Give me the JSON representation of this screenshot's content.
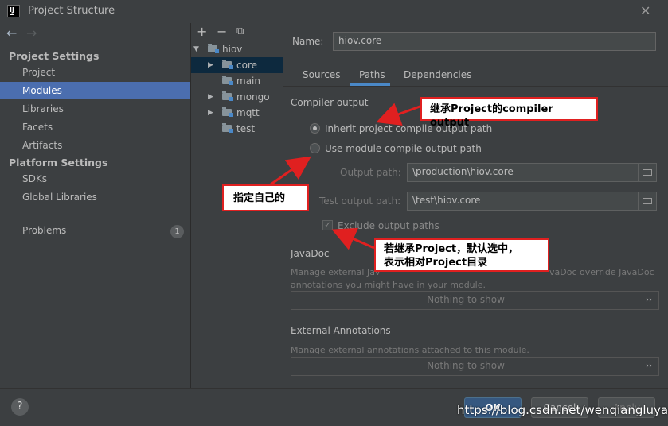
{
  "window": {
    "title": "Project Structure",
    "logo_text": "IJ"
  },
  "sidebar": {
    "sections": [
      {
        "title": "Project Settings",
        "items": [
          "Project",
          "Modules",
          "Libraries",
          "Facets",
          "Artifacts"
        ]
      },
      {
        "title": "Platform Settings",
        "items": [
          "SDKs",
          "Global Libraries"
        ]
      }
    ],
    "selected": "Modules",
    "problems_label": "Problems",
    "problems_count": "1"
  },
  "tree": {
    "root": "hiov",
    "children": [
      "core",
      "main",
      "mongo",
      "mqtt",
      "test"
    ],
    "selected": "core"
  },
  "module": {
    "name_label": "Name:",
    "name_value": "hiov.core",
    "tabs": [
      "Sources",
      "Paths",
      "Dependencies"
    ],
    "active_tab": "Paths"
  },
  "compiler_output": {
    "title": "Compiler output",
    "inherit_label": "Inherit project compile output path",
    "use_module_label": "Use module compile output path",
    "selected": "inherit",
    "output_path_label": "Output path:",
    "output_path_value": "\\production\\hiov.core",
    "test_output_path_label": "Test output path:",
    "test_output_path_value": "\\test\\hiov.core",
    "exclude_label": "Exclude output paths",
    "exclude_checked": true
  },
  "javadoc": {
    "title": "JavaDoc",
    "desc_line1_left": "Manage external Jav",
    "desc_line1_right": "vaDoc override JavaDoc",
    "desc_line2": "annotations you might have in your module.",
    "empty_text": "Nothing to show"
  },
  "external_annotations": {
    "title": "External Annotations",
    "desc": "Manage external annotations attached to this module.",
    "empty_text": "Nothing to show"
  },
  "buttons": {
    "help": "?",
    "ok": "OK",
    "cancel": "Cancel",
    "apply": "Apply"
  },
  "annotations": {
    "callout1": "继承Project的compiler output",
    "callout2": "指定自己的",
    "callout3_line1": "若继承Project，默认选中，",
    "callout3_line2": "表示相对Project目录"
  },
  "watermark": "https://blog.csdn.net/wenqiangluyao",
  "colors": {
    "selection": "#4b6eaf",
    "accent": "#4a88c7",
    "callout_border": "#e02020"
  }
}
